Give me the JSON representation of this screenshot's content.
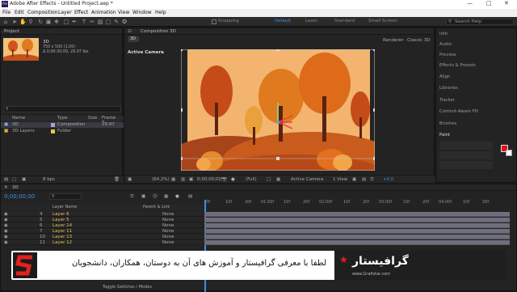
{
  "titlebar": {
    "app_icon": "Ae",
    "title": "Adobe After Effects - Untitled Project.aep *"
  },
  "menu": [
    "File",
    "Edit",
    "Composition",
    "Layer",
    "Effect",
    "Animation",
    "View",
    "Window",
    "Help"
  ],
  "toolbar": {
    "snapping": "Snapping",
    "workspaces": [
      "Default",
      "Learn",
      "Standard",
      "Small Screen"
    ],
    "active_workspace": "Default",
    "search_placeholder": "Search Help"
  },
  "project": {
    "tab": "Project",
    "item_name": "3D",
    "item_info": "750 x 500 (1.00)",
    "item_info2": "Δ 0;00;30;00, 29.97 fps",
    "columns": [
      "Name",
      "Type",
      "Size",
      "Frame R..."
    ],
    "items": [
      {
        "name": "3D",
        "type": "Composition",
        "fps": "29.97"
      },
      {
        "name": "3D Layers",
        "type": "Folder",
        "fps": ""
      }
    ],
    "bpc": "8 bpc"
  },
  "composition": {
    "tab": "Composition 3D",
    "subtab": "3D",
    "active_camera": "Active Camera",
    "renderer_label": "Renderer:",
    "renderer": "Classic 3D",
    "zoom": "(64.2%)",
    "timecode": "0;00;00;00",
    "resolution": "(Full)",
    "camera_view": "Active Camera",
    "views": "1 View",
    "offset": "+0.0"
  },
  "right_panels": [
    "Info",
    "Audio",
    "Preview",
    "Effects & Presets",
    "Align",
    "Libraries",
    "Tracker",
    "Content-Aware Fill",
    "Brushes",
    "Paint"
  ],
  "timeline": {
    "tab": "3D",
    "timecode": "0;00;00;00",
    "columns": {
      "layer_name": "Layer Name",
      "parent": "Parent & Link"
    },
    "ruler": [
      "0f",
      "10f",
      "20f",
      "01:00f",
      "10f",
      "20f",
      "02:00f",
      "10f",
      "20f",
      "03:00f",
      "10f",
      "20f",
      "04:00f",
      "10f",
      "20f"
    ],
    "layers": [
      {
        "num": "4",
        "name": "Layer 6",
        "parent": "None"
      },
      {
        "num": "5",
        "name": "Layer 5",
        "parent": "None"
      },
      {
        "num": "6",
        "name": "Layer 14",
        "parent": "None"
      },
      {
        "num": "7",
        "name": "Layer 11",
        "parent": "None"
      },
      {
        "num": "10",
        "name": "Layer 13",
        "parent": "None"
      },
      {
        "num": "11",
        "name": "Layer 12",
        "parent": "None"
      }
    ],
    "toggle": "Toggle Switches / Modes"
  },
  "banner": {
    "text": "لطفا با معرفی گرافیستار و آموزش های آن به دوستان، همکاران، دانشجویان",
    "brand": "گرافیستار",
    "brand_sub": "www.Grafistar.com"
  },
  "colors": {
    "accent": "#3d8fe0",
    "paint_fg": "#e8101a",
    "logo_red": "#e2211c"
  }
}
